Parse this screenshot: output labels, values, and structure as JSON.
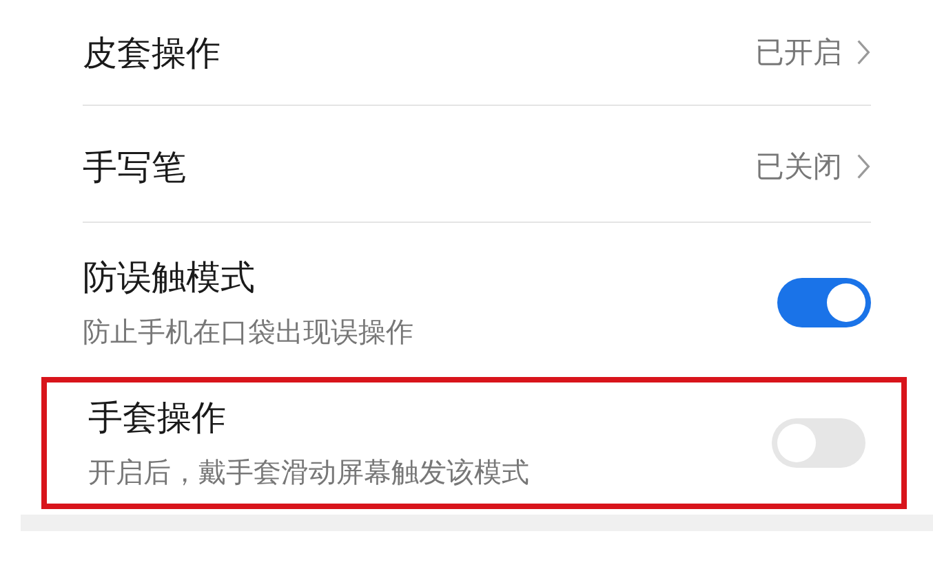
{
  "settings": [
    {
      "kind": "link",
      "title": "皮套操作",
      "value": "已开启"
    },
    {
      "kind": "link",
      "title": "手写笔",
      "value": "已关闭"
    },
    {
      "kind": "switch",
      "title": "防误触模式",
      "subtitle": "防止手机在口袋出现误操作",
      "on": true,
      "highlighted": false
    },
    {
      "kind": "switch",
      "title": "手套操作",
      "subtitle": "开启后，戴手套滑动屏幕触发该模式",
      "on": false,
      "highlighted": true
    }
  ]
}
